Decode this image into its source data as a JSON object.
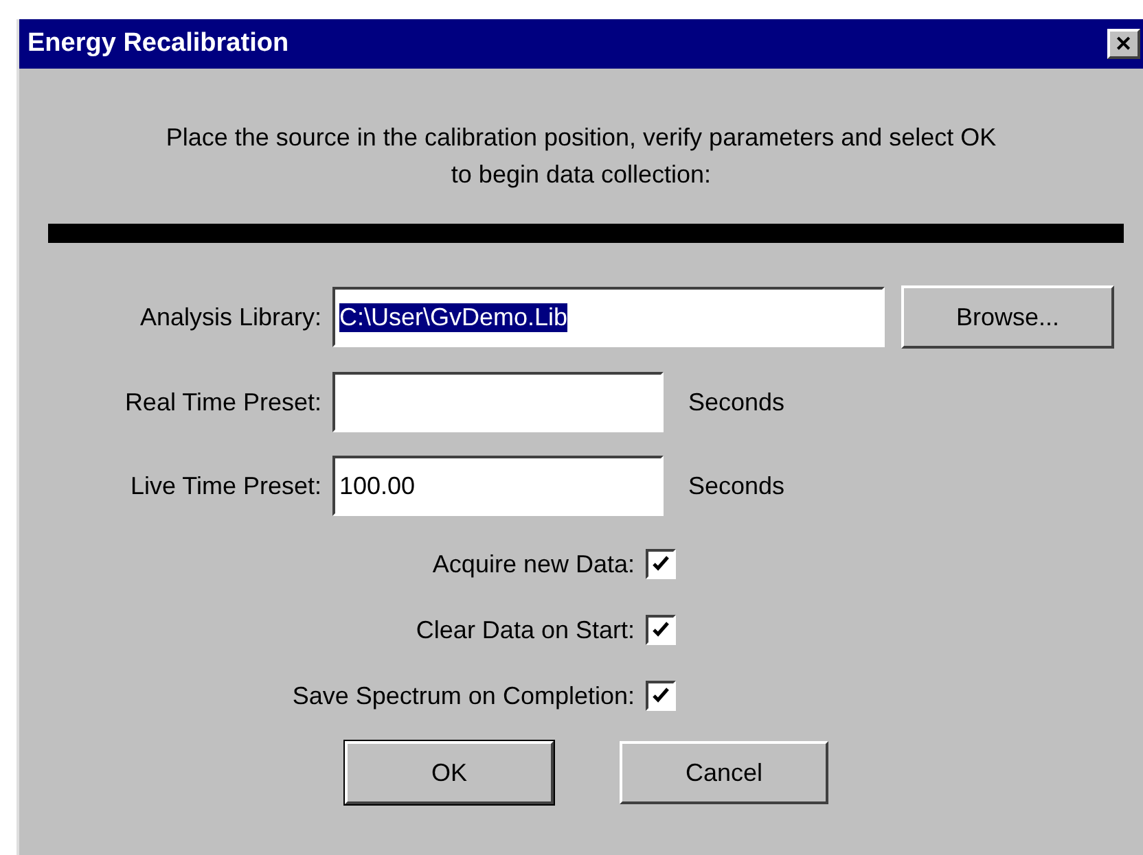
{
  "window": {
    "title": "Energy Recalibration",
    "close": "✕"
  },
  "instruction": "Place the source in the calibration position, verify parameters and select OK to begin data collection:",
  "progress": {
    "level": 1
  },
  "library": {
    "label": "Analysis Library:",
    "value": "C:\\User\\GvDemo.Lib",
    "selected": true,
    "button": "Browse..."
  },
  "presets": [
    {
      "label": "Real Time Preset:",
      "unit": "Seconds"
    },
    {
      "label": "Live Time Preset:",
      "value": "100.00",
      "unit": "Seconds"
    }
  ],
  "options": [
    {
      "label": "Acquire new Data:",
      "checked": true
    },
    {
      "label": "Clear Data on Start:",
      "checked": true
    },
    {
      "label": "Save Spectrum on Completion:",
      "checked": true
    }
  ],
  "buttons": [
    {
      "label": "OK",
      "default": true
    },
    {
      "label": "Cancel",
      "default": false
    }
  ]
}
